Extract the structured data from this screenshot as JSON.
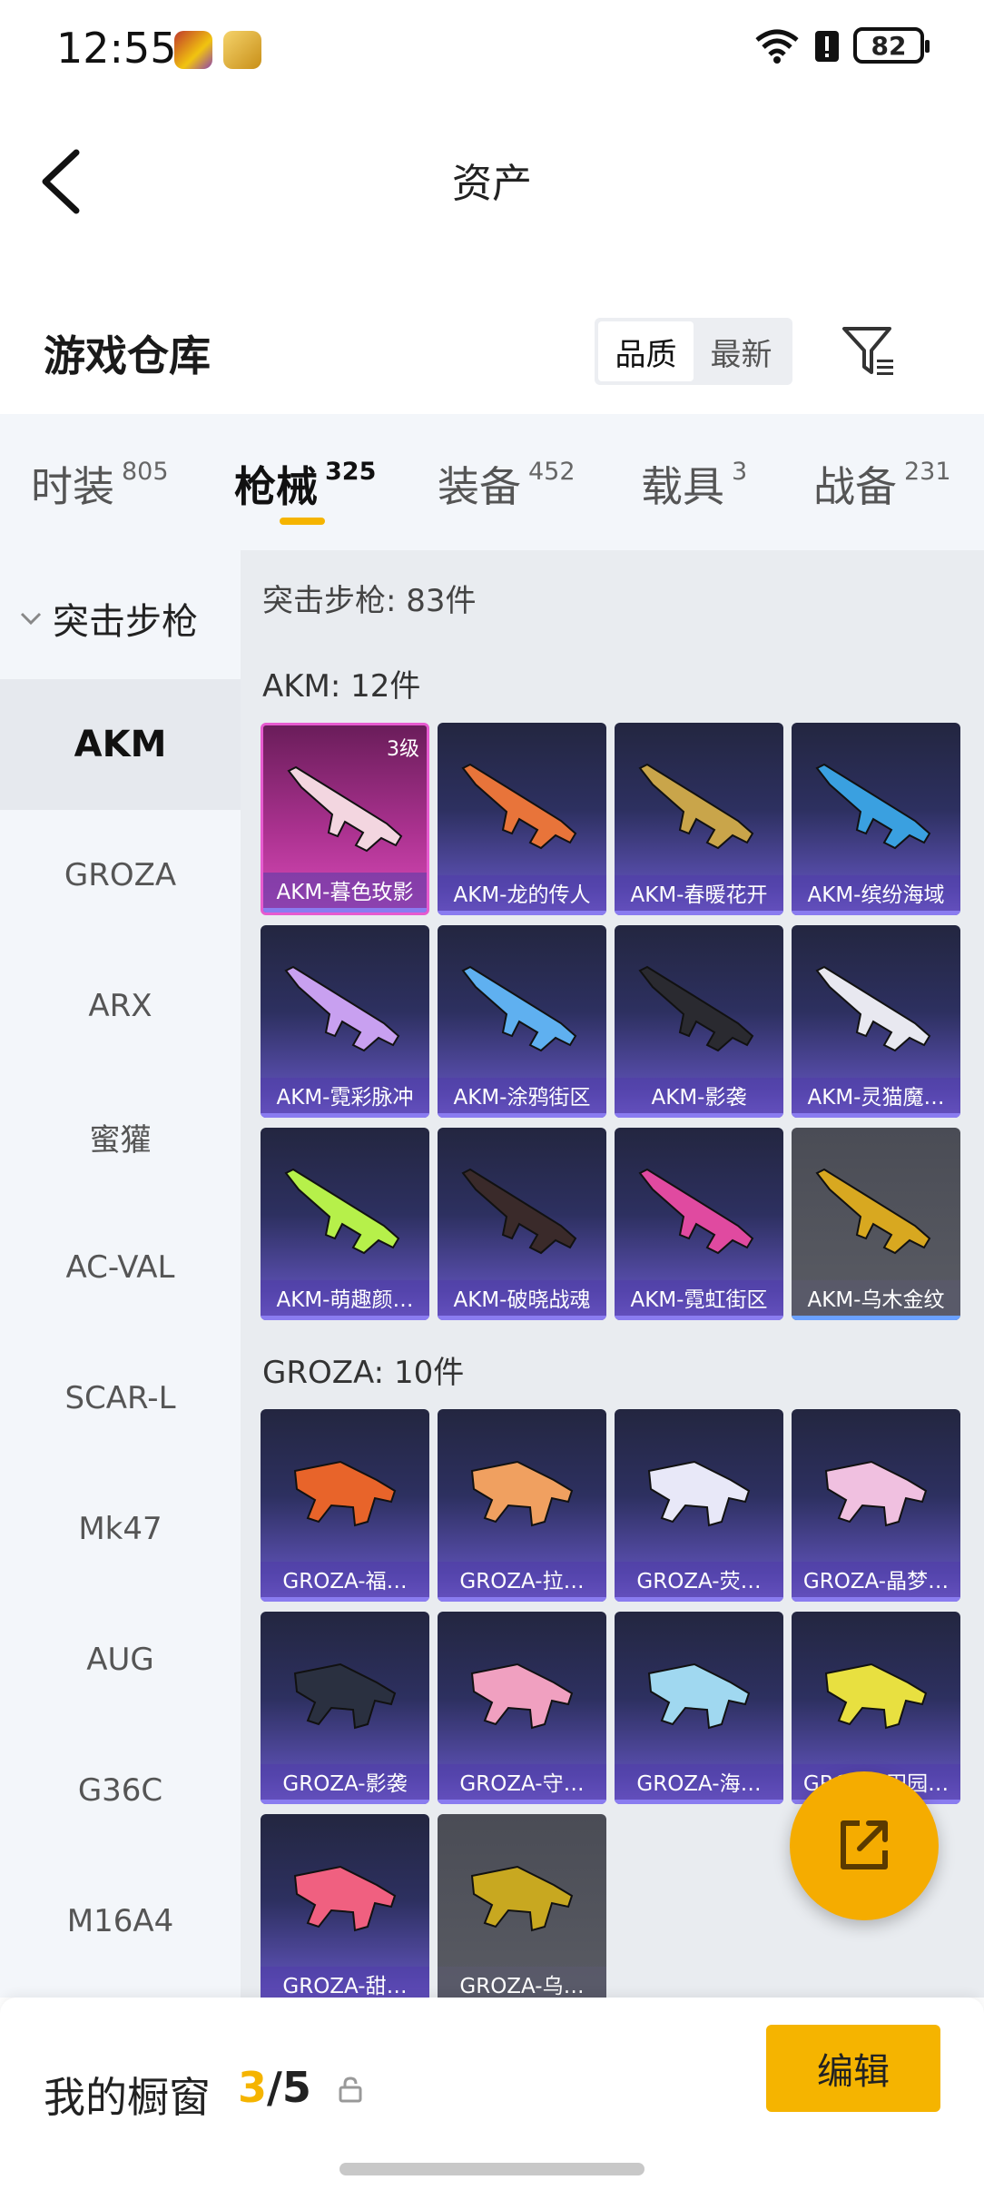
{
  "status_bar": {
    "time": "12:55",
    "battery": "82",
    "icons": [
      "game-app-icon",
      "game-app-icon",
      "wifi-icon",
      "alert-icon",
      "battery-icon"
    ]
  },
  "header": {
    "title": "资产"
  },
  "section": {
    "title": "游戏仓库",
    "sort_options": [
      "品质",
      "最新"
    ],
    "sort_selected": "品质"
  },
  "tabs": [
    {
      "label": "时装",
      "count": "805"
    },
    {
      "label": "枪械",
      "count": "325",
      "active": true
    },
    {
      "label": "装备",
      "count": "452"
    },
    {
      "label": "载具",
      "count": "3"
    },
    {
      "label": "战备",
      "count": "231"
    }
  ],
  "sidebar": {
    "category": "突击步枪",
    "items": [
      "AKM",
      "GROZA",
      "ARX",
      "蜜獾",
      "AC-VAL",
      "SCAR-L",
      "Mk47",
      "AUG",
      "G36C",
      "M16A4"
    ],
    "active": "AKM"
  },
  "content": {
    "summary": "突击步枪: 83件",
    "groups": [
      {
        "title": "AKM: 12件",
        "items": [
          {
            "name": "AKM-暮色玫影",
            "level": "3级",
            "quality": "pink",
            "color": "#f3d6e0"
          },
          {
            "name": "AKM-龙的传人",
            "quality": "purple",
            "color": "#e8743a"
          },
          {
            "name": "AKM-春暖花开",
            "quality": "purple",
            "color": "#c9a54a"
          },
          {
            "name": "AKM-缤纷海域",
            "quality": "purple",
            "color": "#3aa0e0"
          },
          {
            "name": "AKM-霓彩脉冲",
            "quality": "purple",
            "color": "#c8a0f0"
          },
          {
            "name": "AKM-涂鸦街区",
            "quality": "purple",
            "color": "#5fb0f0"
          },
          {
            "name": "AKM-影袭",
            "quality": "purple",
            "color": "#2a2a30"
          },
          {
            "name": "AKM-灵猫魔…",
            "quality": "purple",
            "color": "#e8e8f0"
          },
          {
            "name": "AKM-萌趣颜…",
            "quality": "purple",
            "color": "#b6f04a"
          },
          {
            "name": "AKM-破晓战魂",
            "quality": "purple",
            "color": "#3a2a2a"
          },
          {
            "name": "AKM-霓虹街区",
            "quality": "purple",
            "color": "#e04aa0"
          },
          {
            "name": "AKM-乌木金纹",
            "quality": "grey",
            "color": "#d8a820"
          }
        ]
      },
      {
        "title": "GROZA: 10件",
        "items": [
          {
            "name": "GROZA-福…",
            "quality": "purple",
            "color": "#e8642a"
          },
          {
            "name": "GROZA-拉…",
            "quality": "purple",
            "color": "#f0a060"
          },
          {
            "name": "GROZA-荧…",
            "quality": "purple",
            "color": "#e8e8f8"
          },
          {
            "name": "GROZA-晶梦…",
            "quality": "purple",
            "color": "#f0c0e0"
          },
          {
            "name": "GROZA-影袭",
            "quality": "purple",
            "color": "#2a3040"
          },
          {
            "name": "GROZA-守…",
            "quality": "purple",
            "color": "#f0a0c0"
          },
          {
            "name": "GROZA-海…",
            "quality": "purple",
            "color": "#a0d8f0"
          },
          {
            "name": "GROZA-田园…",
            "quality": "purple",
            "color": "#e8e040"
          },
          {
            "name": "GROZA-甜…",
            "quality": "purple",
            "color": "#f06080"
          },
          {
            "name": "GROZA-乌…",
            "quality": "grey",
            "color": "#c8a820"
          }
        ]
      }
    ]
  },
  "showcase": {
    "label": "我的橱窗",
    "current": "3",
    "total": "/5",
    "edit_label": "编辑"
  },
  "colors": {
    "accent": "#f5b400",
    "fab": "#f5ac00"
  }
}
